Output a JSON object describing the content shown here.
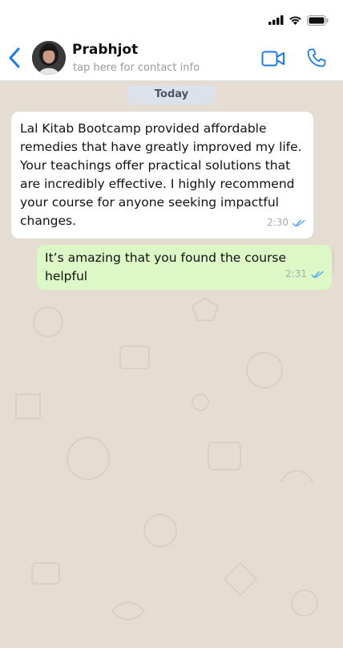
{
  "status_bar": {
    "icons": [
      "cellular-signal-icon",
      "wifi-icon",
      "battery-icon"
    ]
  },
  "header": {
    "contact_name": "Prabhjot",
    "contact_subtitle": "tap here for contact info",
    "icons": [
      "back-arrow-icon",
      "video-call-icon",
      "phone-call-icon"
    ]
  },
  "chat": {
    "date_label": "Today",
    "messages": [
      {
        "direction": "incoming",
        "text": "Lal Kitab Bootcamp provided affordable remedies that have greatly improved my life. Your teachings offer practical solutions that are incredibly effective. I highly recommend your course for anyone seeking impactful changes.",
        "time": "2:30",
        "status_icon": "double-check-icon"
      },
      {
        "direction": "outgoing",
        "text": "It’s amazing that you found the course helpful",
        "time": "2:31",
        "status_icon": "double-check-icon"
      }
    ]
  },
  "colors": {
    "accent_blue": "#1b7ae6",
    "incoming_bubble": "#ffffff",
    "outgoing_bubble": "#dcf8c6",
    "chat_background": "#e6ddd2",
    "date_chip": "#dde1ea"
  }
}
